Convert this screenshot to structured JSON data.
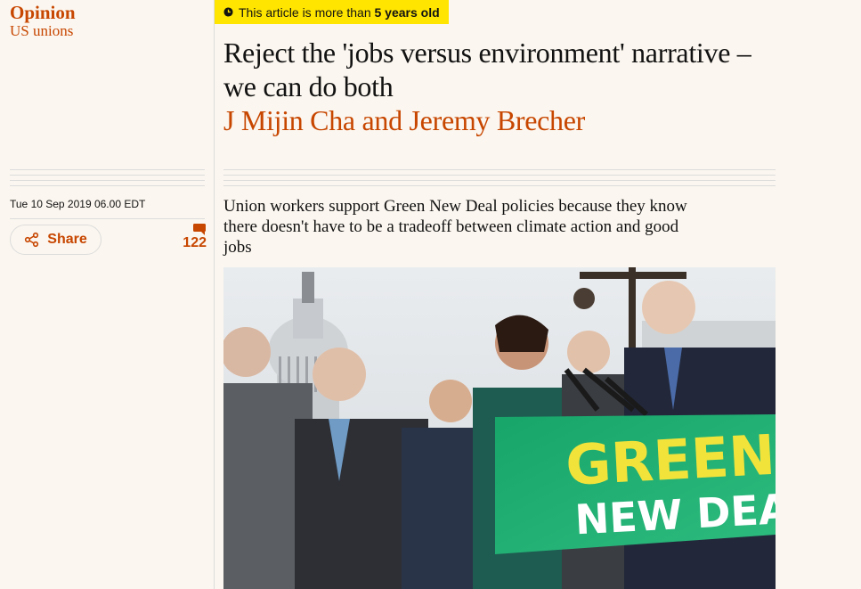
{
  "meta": {
    "section": "Opinion",
    "series": "US unions"
  },
  "age_warning": {
    "prefix": "This article is more than ",
    "emphasis": "5 years old"
  },
  "headline": "Reject the 'jobs versus environment' narrative – we can do both",
  "byline": "J Mijin Cha and Jeremy Brecher",
  "dateline": "Tue 10 Sep 2019 06.00 EDT",
  "share": {
    "label": "Share",
    "icon": "share-icon"
  },
  "comments": {
    "count": "122",
    "icon": "comment-icon"
  },
  "standfirst": "Union workers support Green New Deal policies because they know there doesn't have to be a tradeoff between climate action and good jobs",
  "photo": {
    "sign_line1": "GREEN",
    "sign_line2": "NEW DEAL"
  },
  "colors": {
    "accent": "#c74600",
    "banner": "#ffe500",
    "sign_green": "#1fb06b",
    "sign_yellow": "#f2e33b",
    "background": "#fbf6ef"
  }
}
